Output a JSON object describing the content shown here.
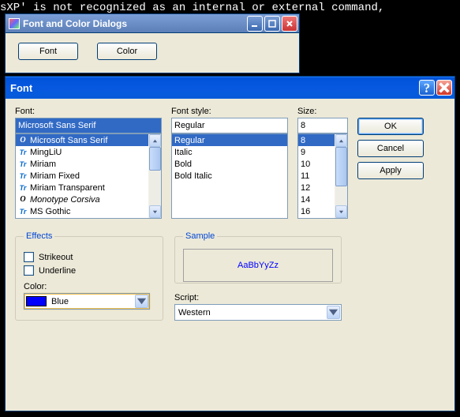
{
  "console": {
    "line": "sXP' is not recognized as an internal or external command,",
    "right_char": ","
  },
  "parent": {
    "title": "Font and Color Dialogs",
    "font_btn": "Font",
    "color_btn": "Color"
  },
  "dialog": {
    "title": "Font",
    "font_label": "Font:",
    "font_value": "Microsoft Sans Serif",
    "font_list": [
      {
        "glyph": "O",
        "name": "Microsoft Sans Serif",
        "selected": true
      },
      {
        "glyph": "Tr",
        "name": "MingLiU"
      },
      {
        "glyph": "Tr",
        "name": "Miriam"
      },
      {
        "glyph": "Tr",
        "name": "Miriam Fixed"
      },
      {
        "glyph": "Tr",
        "name": "Miriam Transparent"
      },
      {
        "glyph": "O",
        "name": "Monotype Corsiva",
        "italic": true
      },
      {
        "glyph": "Tr",
        "name": "MS Gothic"
      }
    ],
    "style_label": "Font style:",
    "style_value": "Regular",
    "style_list": [
      {
        "name": "Regular",
        "selected": true
      },
      {
        "name": "Italic"
      },
      {
        "name": "Bold"
      },
      {
        "name": "Bold Italic"
      }
    ],
    "size_label": "Size:",
    "size_value": "8",
    "size_list": [
      {
        "name": "8",
        "selected": true
      },
      {
        "name": "9"
      },
      {
        "name": "10"
      },
      {
        "name": "11"
      },
      {
        "name": "12"
      },
      {
        "name": "14"
      },
      {
        "name": "16"
      }
    ],
    "ok": "OK",
    "cancel": "Cancel",
    "apply": "Apply",
    "effects_label": "Effects",
    "strikeout": "Strikeout",
    "underline": "Underline",
    "color_label": "Color:",
    "color_name": "Blue",
    "color_hex": "#0000ff",
    "sample_label": "Sample",
    "sample_text": "AaBbYyZz",
    "script_label": "Script:",
    "script_value": "Western"
  }
}
